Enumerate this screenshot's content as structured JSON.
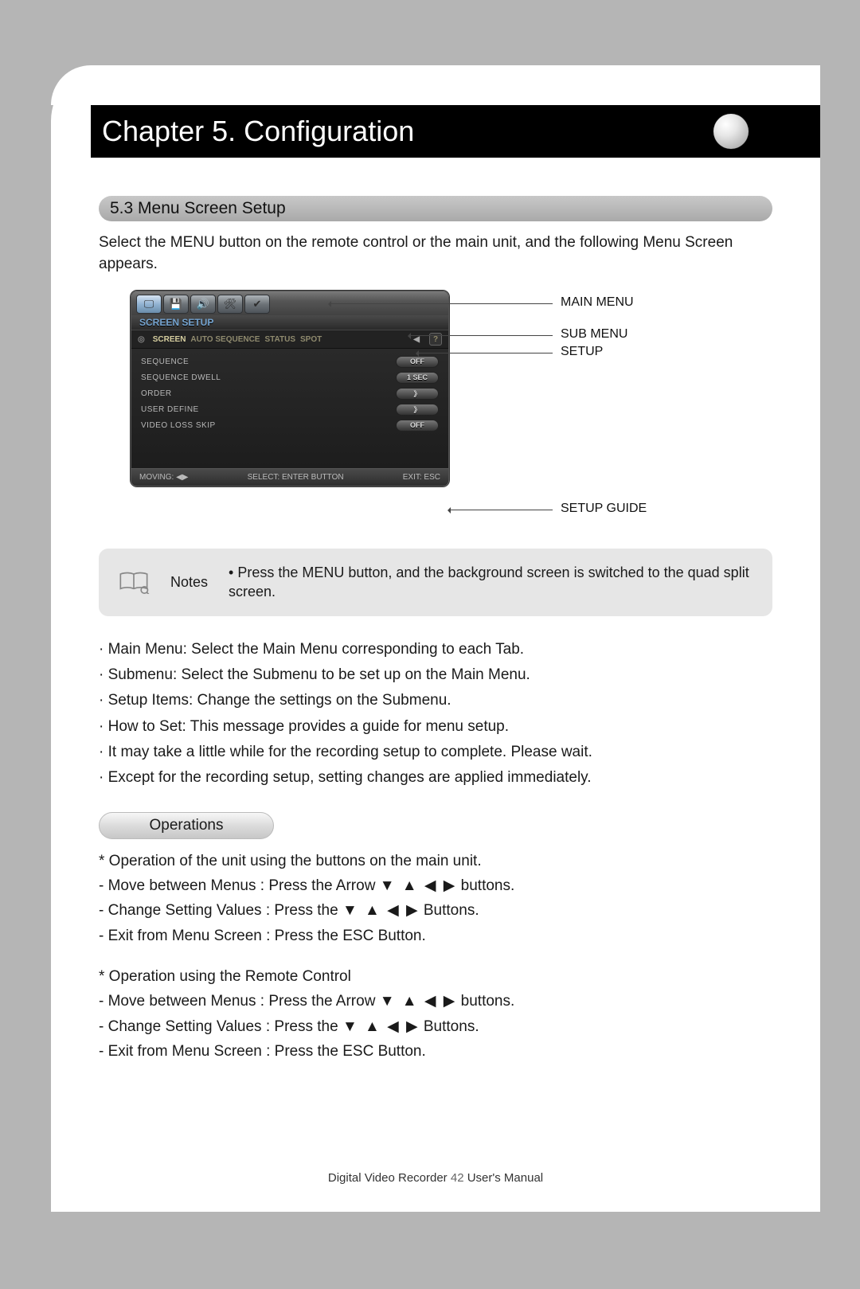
{
  "chapter_title": "Chapter 5. Configuration",
  "section": {
    "number_title": "5.3 Menu Screen Setup",
    "intro": "Select the MENU button on the remote control or the main unit, and the following Menu Screen appears."
  },
  "callouts": {
    "main_menu": "MAIN MENU",
    "sub_menu": "SUB MENU",
    "setup": "SETUP",
    "setup_guide": "SETUP GUIDE"
  },
  "dvr": {
    "heading": "SCREEN SETUP",
    "tabs": [
      "SCREEN",
      "AUTO SEQUENCE",
      "STATUS",
      "SPOT"
    ],
    "rows": [
      {
        "label": "SEQUENCE",
        "value": "OFF"
      },
      {
        "label": "SEQUENCE DWELL",
        "value": "1 SEC"
      },
      {
        "label": "ORDER",
        "value": "》"
      },
      {
        "label": "USER DEFINE",
        "value": "》"
      },
      {
        "label": "VIDEO LOSS SKIP",
        "value": "OFF"
      }
    ],
    "footer": {
      "moving": "MOVING: ◀▶",
      "select": "SELECT: ENTER BUTTON",
      "exit": "EXIT: ESC"
    }
  },
  "notes": {
    "label": "Notes",
    "text": "• Press the MENU button, and the background screen is switched to the quad split screen."
  },
  "bullets": [
    "· Main Menu: Select the Main Menu corresponding to each Tab.",
    "· Submenu: Select the Submenu to be set up on the Main Menu.",
    "· Setup Items: Change the settings on the Submenu.",
    "· How to Set: This message provides a guide for menu setup.",
    "· It may take a little while for the recording setup to complete. Please wait.",
    "· Except for the recording setup, setting changes are applied immediately."
  ],
  "operations": {
    "pill": "Operations",
    "block1": {
      "title": "* Operation of the unit using the buttons on the main unit.",
      "l1a": "- Move between Menus : Press the Arrow ",
      "l1b": " buttons.",
      "l2a": "- Change Setting Values : Press the ",
      "l2b": " Buttons.",
      "l3": "- Exit from Menu Screen : Press the ESC Button."
    },
    "block2": {
      "title": "* Operation using the Remote Control",
      "l1a": "- Move between Menus : Press the Arrow ",
      "l1b": " buttons.",
      "l2a": "- Change Setting Values : Press the ",
      "l2b": " Buttons.",
      "l3": "- Exit from Menu Screen : Press the ESC Button."
    },
    "arrows": "▼ ▲ ◀ ▶"
  },
  "footer": {
    "left": "Digital Video Recorder",
    "page": "42",
    "right": "User's Manual"
  }
}
